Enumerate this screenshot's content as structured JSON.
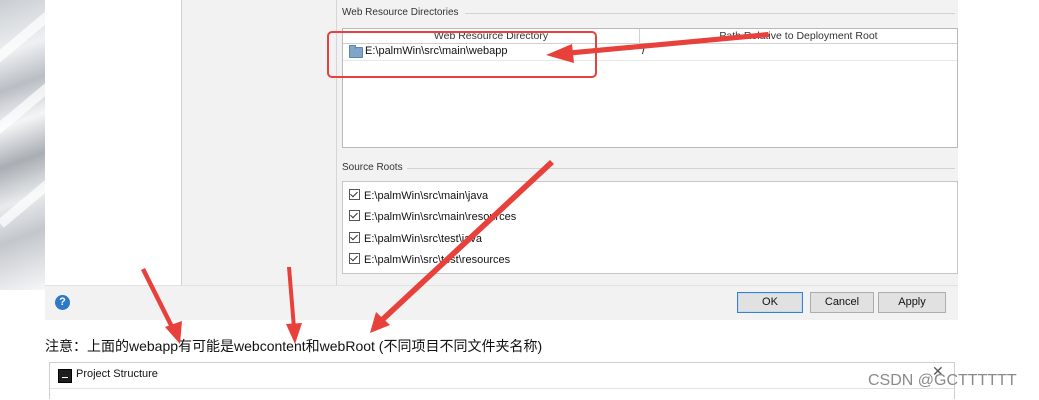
{
  "web_resource": {
    "section_title": "Web Resource Directories",
    "col_directory": "Web Resource Directory",
    "col_path": "Path Relative to Deployment Root",
    "row_directory": "E:\\palmWin\\src\\main\\webapp",
    "row_path": "/"
  },
  "side_toolbar": {
    "add": "+",
    "remove": "—",
    "edit": "✎",
    "help": "?"
  },
  "source_roots": {
    "section_title": "Source Roots",
    "items": [
      "E:\\palmWin\\src\\main\\java",
      "E:\\palmWin\\src\\main\\resources",
      "E:\\palmWin\\src\\test\\java",
      "E:\\palmWin\\src\\test\\resources"
    ]
  },
  "dialog_buttons": {
    "help": "?",
    "ok": "OK",
    "cancel": "Cancel",
    "apply": "Apply"
  },
  "note_text": "注意：上面的webapp有可能是webcontent和webRoot (不同项目不同文件夹名称)",
  "second_window": {
    "title": "Project Structure",
    "close": "✕"
  },
  "watermark": "CSDN @GCTTTTTT",
  "colors": {
    "annotation_red": "#e8403a",
    "ok_border": "#3b7fd0",
    "help_blue": "#2e78c7"
  },
  "icons": [
    "folder-icon",
    "checkbox-icon",
    "help-icon",
    "intellij-icon",
    "close-icon"
  ]
}
